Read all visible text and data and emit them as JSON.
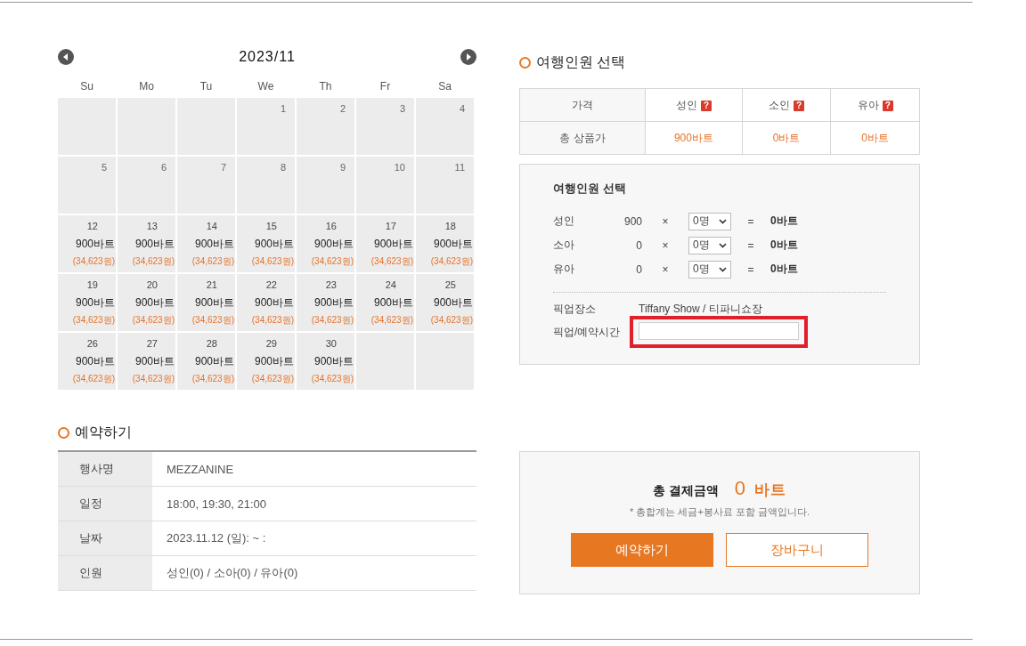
{
  "calendar": {
    "title": "2023/11",
    "weekdays": [
      "Su",
      "Mo",
      "Tu",
      "We",
      "Th",
      "Fr",
      "Sa"
    ],
    "cells": [
      {
        "kind": "blank"
      },
      {
        "kind": "blank"
      },
      {
        "kind": "blank"
      },
      {
        "kind": "day",
        "day": "1"
      },
      {
        "kind": "day",
        "day": "2"
      },
      {
        "kind": "day",
        "day": "3"
      },
      {
        "kind": "day",
        "day": "4"
      },
      {
        "kind": "day",
        "day": "5"
      },
      {
        "kind": "day",
        "day": "6"
      },
      {
        "kind": "day",
        "day": "7"
      },
      {
        "kind": "day",
        "day": "8"
      },
      {
        "kind": "day",
        "day": "9"
      },
      {
        "kind": "day",
        "day": "10"
      },
      {
        "kind": "day",
        "day": "11"
      },
      {
        "kind": "priced",
        "day": "12",
        "price": "900바트",
        "won": "(34,623원)"
      },
      {
        "kind": "priced",
        "day": "13",
        "price": "900바트",
        "won": "(34,623원)"
      },
      {
        "kind": "priced",
        "day": "14",
        "price": "900바트",
        "won": "(34,623원)"
      },
      {
        "kind": "priced",
        "day": "15",
        "price": "900바트",
        "won": "(34,623원)"
      },
      {
        "kind": "priced",
        "day": "16",
        "price": "900바트",
        "won": "(34,623원)"
      },
      {
        "kind": "priced",
        "day": "17",
        "price": "900바트",
        "won": "(34,623원)"
      },
      {
        "kind": "priced",
        "day": "18",
        "price": "900바트",
        "won": "(34,623원)"
      },
      {
        "kind": "priced",
        "day": "19",
        "price": "900바트",
        "won": "(34,623원)"
      },
      {
        "kind": "priced",
        "day": "20",
        "price": "900바트",
        "won": "(34,623원)"
      },
      {
        "kind": "priced",
        "day": "21",
        "price": "900바트",
        "won": "(34,623원)"
      },
      {
        "kind": "priced",
        "day": "22",
        "price": "900바트",
        "won": "(34,623원)"
      },
      {
        "kind": "priced",
        "day": "23",
        "price": "900바트",
        "won": "(34,623원)"
      },
      {
        "kind": "priced",
        "day": "24",
        "price": "900바트",
        "won": "(34,623원)"
      },
      {
        "kind": "priced",
        "day": "25",
        "price": "900바트",
        "won": "(34,623원)"
      },
      {
        "kind": "priced",
        "day": "26",
        "price": "900바트",
        "won": "(34,623원)"
      },
      {
        "kind": "priced",
        "day": "27",
        "price": "900바트",
        "won": "(34,623원)"
      },
      {
        "kind": "priced",
        "day": "28",
        "price": "900바트",
        "won": "(34,623원)"
      },
      {
        "kind": "priced",
        "day": "29",
        "price": "900바트",
        "won": "(34,623원)"
      },
      {
        "kind": "priced",
        "day": "30",
        "price": "900바트",
        "won": "(34,623원)"
      },
      {
        "kind": "blank"
      },
      {
        "kind": "blank"
      }
    ]
  },
  "booking": {
    "title": "예약하기",
    "rows": [
      {
        "label": "행사명",
        "value": "MEZZANINE"
      },
      {
        "label": "일정",
        "value": "18:00, 19:30, 21:00"
      },
      {
        "label": "날짜",
        "value": "2023.11.12 (일): ~ :"
      },
      {
        "label": "인원",
        "value": "성인(0) / 소아(0) / 유아(0)"
      }
    ]
  },
  "travelers": {
    "title": "여행인원 선택",
    "price_table": {
      "corner": "가격",
      "columns": [
        {
          "label": "성인",
          "help": "?"
        },
        {
          "label": "소인",
          "help": "?"
        },
        {
          "label": "유아",
          "help": "?"
        }
      ],
      "row_label": "총 상품가",
      "prices": [
        "900바트",
        "0바트",
        "0바트"
      ]
    },
    "panel": {
      "title": "여행인원 선택",
      "rows": [
        {
          "label": "성인",
          "unit": "900",
          "times": "×",
          "count": "0명",
          "equals": "=",
          "subtotal": "0바트"
        },
        {
          "label": "소아",
          "unit": "0",
          "times": "×",
          "count": "0명",
          "equals": "=",
          "subtotal": "0바트"
        },
        {
          "label": "유아",
          "unit": "0",
          "times": "×",
          "count": "0명",
          "equals": "=",
          "subtotal": "0바트"
        }
      ],
      "pickup_place": {
        "label": "픽업장소",
        "value": "Tiffany Show / 티파니쇼장"
      },
      "pickup_time": {
        "label": "픽업/예약시간",
        "highlighted": true
      }
    }
  },
  "payment": {
    "label": "총 결제금액",
    "amount": "0",
    "currency": "바트",
    "note": "* 총합계는 세금+봉사료 포함 금액입니다.",
    "buttons": [
      {
        "kind": "primary",
        "label": "예약하기"
      },
      {
        "kind": "outline",
        "label": "장바구니"
      }
    ]
  }
}
